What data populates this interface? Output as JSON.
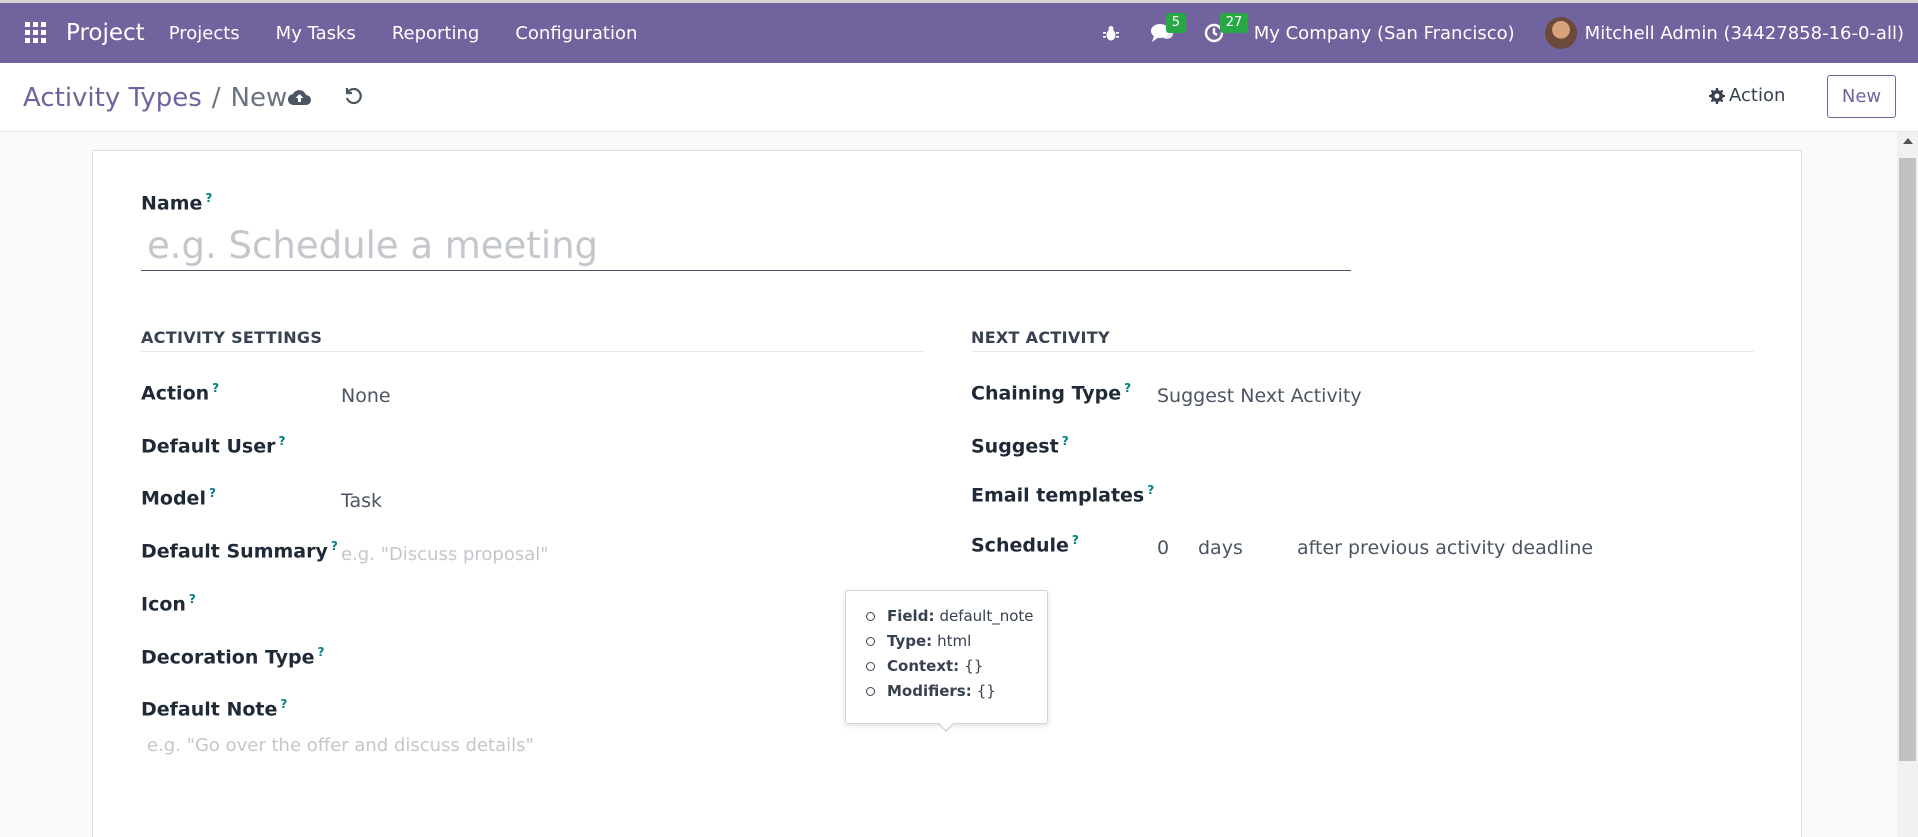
{
  "navbar": {
    "brand": "Project",
    "menu": [
      "Projects",
      "My Tasks",
      "Reporting",
      "Configuration"
    ],
    "messages_count": "5",
    "activities_count": "27",
    "company": "My Company (San Francisco)",
    "user": "Mitchell Admin (34427858-16-0-all)",
    "color": "#71639e"
  },
  "control_panel": {
    "breadcrumb_parent": "Activity Types",
    "breadcrumb_separator": "/",
    "breadcrumb_current": "New",
    "action_label": "Action",
    "new_label": "New"
  },
  "form": {
    "name_label": "Name",
    "name_placeholder": "e.g. Schedule a meeting",
    "help_mark": "?",
    "activity_settings": {
      "title": "ACTIVITY SETTINGS",
      "action_label": "Action",
      "action_value": "None",
      "default_user_label": "Default User",
      "model_label": "Model",
      "model_value": "Task",
      "default_summary_label": "Default Summary",
      "default_summary_placeholder": "e.g. \"Discuss proposal\"",
      "icon_label": "Icon",
      "decoration_type_label": "Decoration Type",
      "default_note_label": "Default Note",
      "default_note_placeholder": "e.g. \"Go over the offer and discuss details\""
    },
    "next_activity": {
      "title": "NEXT ACTIVITY",
      "chaining_type_label": "Chaining Type",
      "chaining_type_value": "Suggest Next Activity",
      "suggest_label": "Suggest",
      "email_templates_label": "Email templates",
      "schedule_label": "Schedule",
      "schedule_delay": "0",
      "schedule_unit": "days",
      "schedule_from": "after previous activity deadline"
    }
  },
  "tooltip": {
    "field_label": "Field:",
    "field_value": "default_note",
    "type_label": "Type:",
    "type_value": "html",
    "context_label": "Context:",
    "context_value": "{}",
    "modifiers_label": "Modifiers:",
    "modifiers_value": "{}"
  }
}
